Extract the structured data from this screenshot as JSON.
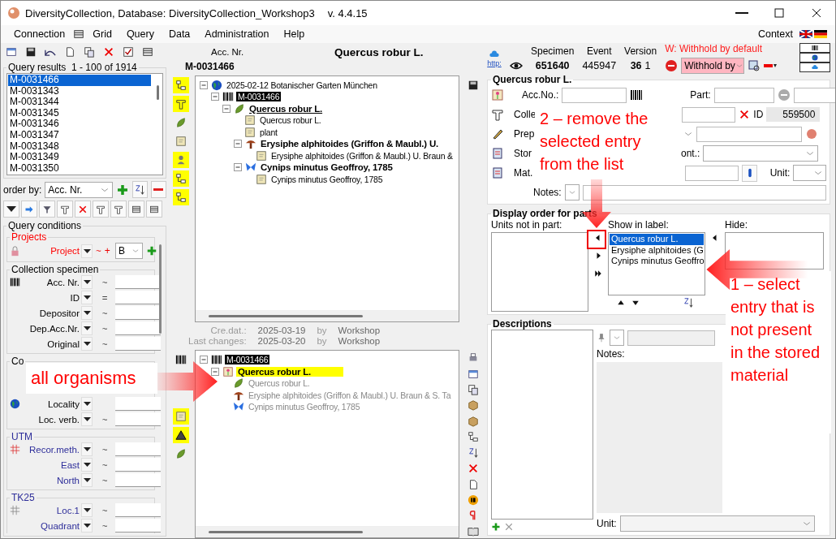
{
  "window": {
    "title": "DiversityCollection,  Database: DiversityCollection_Workshop3",
    "version": "v. 4.4.15"
  },
  "menu": {
    "items": [
      "Connection",
      "Grid",
      "Query",
      "Data",
      "Administration",
      "Help"
    ],
    "context": "Context"
  },
  "query_results": {
    "title": "Query results",
    "range": "1 - 100 of 1914",
    "items": [
      {
        "label": "M-0031466",
        "selected": true
      },
      {
        "label": "M-0031343",
        "selected": false
      },
      {
        "label": "M-0031344",
        "selected": false
      },
      {
        "label": "M-0031345",
        "selected": false
      },
      {
        "label": "M-0031346",
        "selected": false
      },
      {
        "label": "M-0031347",
        "selected": false
      },
      {
        "label": "M-0031348",
        "selected": false
      },
      {
        "label": "M-0031349",
        "selected": false
      },
      {
        "label": "M-0031350",
        "selected": false
      }
    ]
  },
  "order_by": {
    "label": "order by:",
    "value": "Acc. Nr."
  },
  "query_conditions": {
    "title": "Query conditions",
    "groups": [
      {
        "title": "Projects",
        "color": "#ff0000",
        "rows": [
          {
            "kind": "project",
            "label": "Project",
            "operator": "~",
            "extra": "+",
            "value": "B"
          }
        ]
      },
      {
        "title": "Collection specimen",
        "color": "#000000",
        "rows": [
          {
            "kind": "text",
            "label": "Acc. Nr.",
            "operator": "~"
          },
          {
            "kind": "text",
            "label": "ID",
            "operator": "="
          },
          {
            "kind": "text",
            "label": "Depositor",
            "operator": "~"
          },
          {
            "kind": "text",
            "label": "Dep.Acc.Nr.",
            "operator": "~"
          },
          {
            "kind": "text",
            "label": "Original",
            "operator": "~"
          }
        ]
      },
      {
        "title": "Co",
        "color": "#000000",
        "rows": [
          {
            "kind": "text",
            "label": "Locality"
          },
          {
            "kind": "text",
            "label": "Loc. verb.",
            "operator": "~"
          }
        ]
      },
      {
        "title": "UTM",
        "color": "#2e2e9a",
        "rows": [
          {
            "kind": "text",
            "label": "Recor.meth.",
            "operator": "~"
          },
          {
            "kind": "text",
            "label": "East",
            "operator": "~"
          },
          {
            "kind": "text",
            "label": "North",
            "operator": "~"
          }
        ]
      },
      {
        "title": "TK25",
        "color": "#2e2e9a",
        "rows": [
          {
            "kind": "text",
            "label": "Loc.1",
            "operator": "~"
          },
          {
            "kind": "text",
            "label": "Quadrant",
            "operator": "~"
          }
        ]
      }
    ]
  },
  "record": {
    "acc_label": "Acc. Nr.",
    "acc_value": "M-0031466",
    "title": "Quercus robur L."
  },
  "tree": [
    {
      "kind": "event",
      "label": "2025-02-12 Botanischer Garten München",
      "selected": false,
      "expanded": true,
      "children": [
        {
          "kind": "specimen",
          "label": "M-0031466",
          "selected": true,
          "expanded": true,
          "children": [
            {
              "kind": "plant",
              "label": "Quercus robur L.",
              "selected": false,
              "current": true,
              "expanded": true,
              "children": [
                {
                  "kind": "label",
                  "label": "Quercus robur L.",
                  "selected": false
                },
                {
                  "kind": "label",
                  "label": "plant",
                  "selected": false
                },
                {
                  "kind": "fungus",
                  "label": "Erysiphe alphitoides (Griffon & Maubl.) U.",
                  "selected": false,
                  "expanded": true,
                  "children": [
                    {
                      "kind": "label",
                      "label": "Erysiphe alphitoides (Griffon & Maubl.) U. Braun &",
                      "selected": false
                    }
                  ]
                },
                {
                  "kind": "insect",
                  "label": "Cynips minutus Geoffroy, 1785",
                  "selected": false,
                  "expanded": true,
                  "children": [
                    {
                      "kind": "label",
                      "label": "Cynips minutus Geoffroy, 1785",
                      "selected": false
                    }
                  ]
                }
              ]
            }
          ]
        }
      ]
    }
  ],
  "metadata": [
    {
      "label": "Cre.dat.:",
      "date": "2025-03-19",
      "by": "by",
      "user": "Workshop"
    },
    {
      "label": "Last changes:",
      "date": "2025-03-20",
      "by": "by",
      "user": "Workshop"
    }
  ],
  "part_tree": [
    {
      "kind": "specimen",
      "label": "M-0031466",
      "selected": true,
      "expanded": true,
      "children": [
        {
          "kind": "part",
          "label": "Quercus robur L.",
          "selected": false,
          "marked": true,
          "expanded": true,
          "children": [
            {
              "kind": "plant",
              "label": "Quercus robur L.",
              "selected": false,
              "dimmed": true
            },
            {
              "kind": "fungus",
              "label": "Erysiphe alphitoides (Griffon & Maubl.) U. Braun & S. Ta",
              "selected": false,
              "dimmed": true
            },
            {
              "kind": "insect",
              "label": "Cynips minutus Geoffroy, 1785",
              "selected": false,
              "dimmed": true
            }
          ]
        }
      ]
    }
  ],
  "header": {
    "link": "http:",
    "columns": [
      {
        "label": "Specimen",
        "value": "651640",
        "bold": true
      },
      {
        "label": "Event",
        "value": "445947",
        "bold": false
      },
      {
        "label": "Version",
        "value": "36",
        "extra": "1",
        "bold": true
      }
    ],
    "warning": "W: Withhold by default",
    "withhold": "Withhold by"
  },
  "part_form": {
    "title": "Quercus robur L.",
    "acc_label": "Acc.No.:",
    "part_label": "Part:",
    "collector_label": "Colle",
    "id_label": "ID",
    "id_value": "559500",
    "prep_label": "Prep",
    "storage_label": "Stor",
    "cont_label": "ont.:",
    "material_label": "Mat.",
    "unit_label": "Unit:",
    "notes_label": "Notes:"
  },
  "display_order": {
    "title": "Display order for parts",
    "not_in_part": "Units not in part:",
    "show_label": "Show in label:",
    "hide_label": "Hide:",
    "items": [
      {
        "label": "Quercus robur L.",
        "selected": true
      },
      {
        "label": "Erysiphe alphitoides (G",
        "selected": false
      },
      {
        "label": "Cynips minutus Geoffro",
        "selected": false
      }
    ]
  },
  "descriptions": {
    "title": "Descriptions",
    "notes_label": "Notes:",
    "unit_label": "Unit:"
  },
  "annotations": [
    {
      "text": "2 – remove the selected entry from the list"
    },
    {
      "text": "1 – select entry that is not present in the stored material"
    },
    {
      "text": "all organisms"
    }
  ]
}
